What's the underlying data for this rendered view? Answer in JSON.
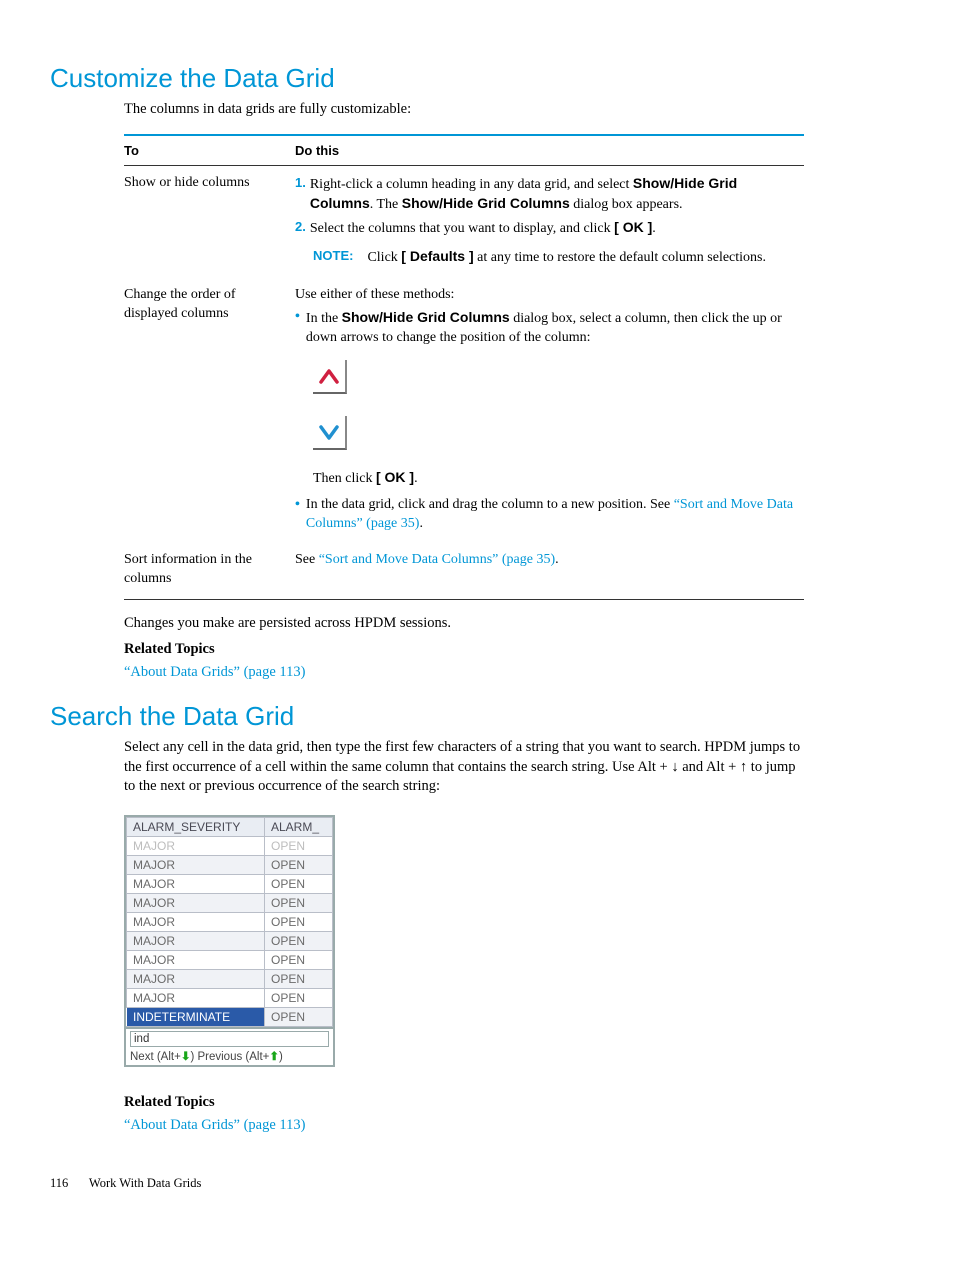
{
  "section1": {
    "heading": "Customize the Data Grid",
    "intro": "The columns in data grids are fully customizable:",
    "table": {
      "head_to": "To",
      "head_dothis": "Do this",
      "rows": [
        {
          "to": "Show or hide columns",
          "step1_pre": "Right-click a column heading in any data grid, and select ",
          "step1_bold1": "Show/Hide Grid Columns",
          "step1_post1": ". The ",
          "step1_bold2": "Show/Hide Grid Columns",
          "step1_post2": " dialog box appears.",
          "step2_pre": "Select the columns that you want to display, and click ",
          "step2_bold": "[ OK ]",
          "step2_post": ".",
          "note_label": "NOTE:",
          "note_pre": "Click ",
          "note_bold": "[ Defaults ]",
          "note_post": " at any time to restore the default column selections."
        },
        {
          "to": "Change the order of displayed columns",
          "lead": "Use either of these methods:",
          "b1_pre": "In the ",
          "b1_bold": "Show/Hide Grid Columns",
          "b1_post": " dialog box, select a column, then click the up or down arrows to change the position of the column:",
          "then_pre": "Then click ",
          "then_bold": "[ OK ]",
          "then_post": ".",
          "b2_pre": "In the data grid, click and drag the column to a new position. See ",
          "b2_link": "“Sort and Move Data Columns” (page 35)",
          "b2_post": "."
        },
        {
          "to": "Sort information in the columns",
          "d_pre": "See ",
          "d_link": "“Sort and Move Data Columns” (page 35)",
          "d_post": "."
        }
      ]
    },
    "outro": "Changes you make are persisted across HPDM sessions.",
    "related_heading": "Related Topics",
    "related_link": "“About Data Grids” (page 113)"
  },
  "section2": {
    "heading": "Search the Data Grid",
    "para": "Select any cell in the data grid, then type the first few characters of a string that you want to search. HPDM jumps to the first occurrence of a cell within the same column that contains the search string. Use Alt + ↓ and Alt + ↑ to jump to the next or previous occurrence of the search string:",
    "grid": {
      "col1": "ALARM_SEVERITY",
      "col2": "ALARM_",
      "rows": [
        {
          "sev": "MAJOR",
          "st": "OPEN",
          "partial": true
        },
        {
          "sev": "MAJOR",
          "st": "OPEN"
        },
        {
          "sev": "MAJOR",
          "st": "OPEN"
        },
        {
          "sev": "MAJOR",
          "st": "OPEN"
        },
        {
          "sev": "MAJOR",
          "st": "OPEN"
        },
        {
          "sev": "MAJOR",
          "st": "OPEN"
        },
        {
          "sev": "MAJOR",
          "st": "OPEN"
        },
        {
          "sev": "MAJOR",
          "st": "OPEN"
        },
        {
          "sev": "MAJOR",
          "st": "OPEN"
        },
        {
          "sev": "INDETERMINATE",
          "st": "OPEN",
          "sel": true
        }
      ],
      "search_value": "ind",
      "nav_next": "Next (Alt+",
      "nav_prev": ") Previous (Alt+",
      "nav_end": ")"
    },
    "related_heading": "Related Topics",
    "related_link": "“About Data Grids” (page 113)"
  },
  "footer": {
    "page_number": "116",
    "chapter": "Work With Data Grids"
  }
}
